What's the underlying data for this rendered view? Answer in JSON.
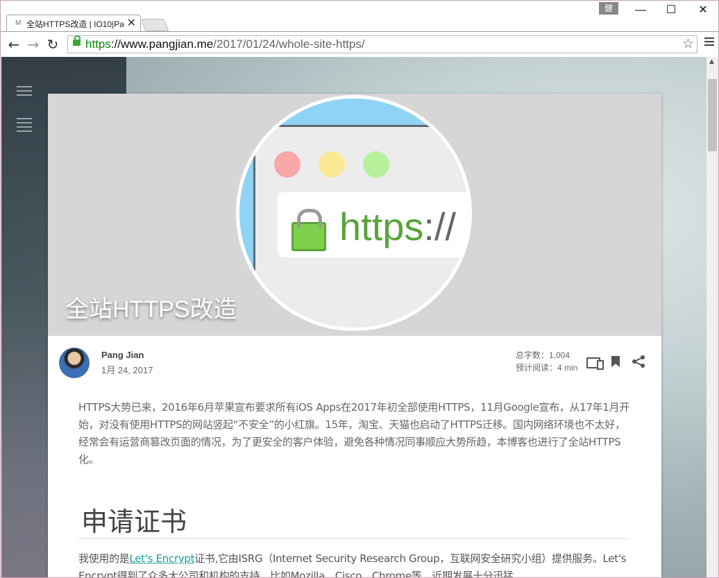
{
  "browser": {
    "tab_favicon": "M",
    "tab_title": "全站HTTPS改造 | IO10|Pa",
    "tab_close": "✕",
    "user_badge": "健",
    "minimize": "—",
    "maximize": "☐",
    "close": "✕",
    "url_scheme": "https",
    "url_host": "://www.pangjian.me",
    "url_path": "/2017/01/24/whole-site-https/",
    "back_icon": "←",
    "forward_icon": "→",
    "reload_icon": "↻",
    "star_icon": "☆"
  },
  "hero": {
    "title": "全站HTTPS改造",
    "https_text": "https",
    "https_slash": "://"
  },
  "author": {
    "name": "Pang Jian",
    "date": "1月 24, 2017",
    "word_count": "总字数：1,004",
    "read_time": "预计阅读：4 min"
  },
  "article": {
    "intro": "HTTPS大势已来，2016年6月苹果宣布要求所有iOS Apps在2017年初全部使用HTTPS，11月Google宣布，从17年1月开始，对没有使用HTTPS的网站竖起“不安全”的小红旗。15年，淘宝、天猫也启动了HTTPS迁移。国内网络环境也不太好，经常会有运营商篡改页面的情况，为了更安全的客户体验，避免各种情况同事顺应大势所趋，本博客也进行了全站HTTPS化。",
    "section_title": "申请证书",
    "p2_before": "我使用的是",
    "p2_link": "Let's Encrypt",
    "p2_after": "证书,它由ISRG（Internet Security Research Group，互联网安全研究小组）提供服务。Let's Encrypt得到了众多大公司和机构的支持，比如Mozilla、Cisco、Chrome等，近期发展十分迅猛"
  }
}
